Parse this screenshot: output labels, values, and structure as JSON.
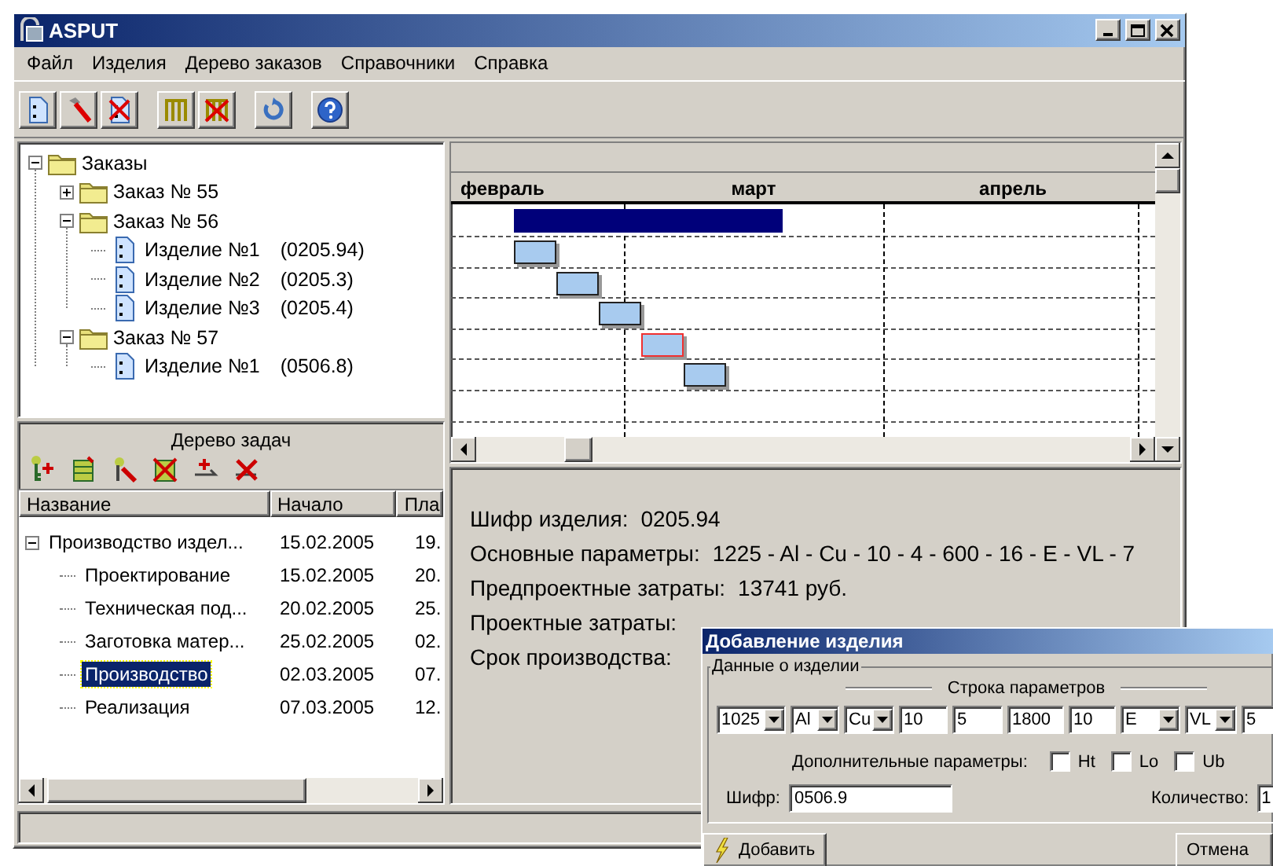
{
  "window": {
    "title": "ASPUT"
  },
  "menu": [
    "Файл",
    "Изделия",
    "Дерево заказов",
    "Справочники",
    "Справка"
  ],
  "order_tree": {
    "label": "Заказы",
    "expanded": true,
    "children": [
      {
        "label": "Заказ №  55",
        "expanded": false
      },
      {
        "label": "Заказ №  56",
        "expanded": true,
        "children": [
          {
            "label": "Изделие №1",
            "code": "(0205.94)"
          },
          {
            "label": "Изделие №2",
            "code": "(0205.3)"
          },
          {
            "label": "Изделие №3",
            "code": "(0205.4)"
          }
        ]
      },
      {
        "label": "Заказ №  57",
        "expanded": true,
        "children": [
          {
            "label": "Изделие №1",
            "code": "(0506.8)"
          }
        ]
      }
    ]
  },
  "task_panel": {
    "title": "Дерево задач",
    "columns": [
      "Название",
      "Начало",
      "Пла"
    ],
    "rows": [
      {
        "name": "Производство издел...",
        "start": "15.02.2005",
        "column_3": "19.",
        "expanded": true,
        "selected": false,
        "children": [
          {
            "name": "Проектирование",
            "start": "15.02.2005",
            "column_3": "20.",
            "selected": false
          },
          {
            "name": "Техническая под...",
            "start": "20.02.2005",
            "column_3": "25.",
            "selected": false
          },
          {
            "name": "Заготовка матер...",
            "start": "25.02.2005",
            "column_3": "02.",
            "selected": false
          },
          {
            "name": "Производство",
            "start": "02.03.2005",
            "column_3": "07.",
            "selected": true
          },
          {
            "name": "Реализация",
            "start": "07.03.2005",
            "column_3": "12.",
            "selected": false
          }
        ]
      }
    ]
  },
  "gantt": {
    "months": [
      "февраль",
      "март",
      "апрель"
    ],
    "bars": [
      {
        "kind": "summary"
      },
      {
        "kind": "task",
        "selected": false
      },
      {
        "kind": "task",
        "selected": false
      },
      {
        "kind": "task",
        "selected": false
      },
      {
        "kind": "task",
        "selected": true
      },
      {
        "kind": "task",
        "selected": false
      }
    ]
  },
  "details": [
    {
      "label": "Шифр изделия:",
      "value": "0205.94"
    },
    {
      "label": "Основные параметры:",
      "value": "1225 - Al - Cu - 10 - 4 - 600 - 16 - E - VL - 7"
    },
    {
      "label": "Предпроектные затраты:",
      "value": "13741 руб."
    },
    {
      "label": "Проектные затраты:"
    },
    {
      "label": "Срок производства:"
    }
  ],
  "dialog": {
    "title": "Добавление изделия",
    "group": "Данные о изделии",
    "params_title": "Строка параметров",
    "params": [
      {
        "kind": "combo",
        "value": "1025"
      },
      {
        "kind": "combo",
        "value": "Al"
      },
      {
        "kind": "combo",
        "value": "Cu"
      },
      {
        "kind": "text",
        "value": "10"
      },
      {
        "kind": "text",
        "value": "5"
      },
      {
        "kind": "text",
        "value": "1800"
      },
      {
        "kind": "text",
        "value": "10"
      },
      {
        "kind": "combo",
        "value": "E"
      },
      {
        "kind": "combo",
        "value": "VL"
      },
      {
        "kind": "text",
        "value": "5"
      }
    ],
    "extra_label": "Дополнительные параметры:",
    "extras": [
      {
        "label": "Ht",
        "checked": false
      },
      {
        "label": "Lo",
        "checked": false
      },
      {
        "label": "Ub",
        "checked": false
      }
    ],
    "code_label": "Шифр:",
    "code": "0506.9",
    "qty_label": "Количество:",
    "qty": "1",
    "add_button": "Добавить",
    "cancel_button": "Отмена"
  }
}
